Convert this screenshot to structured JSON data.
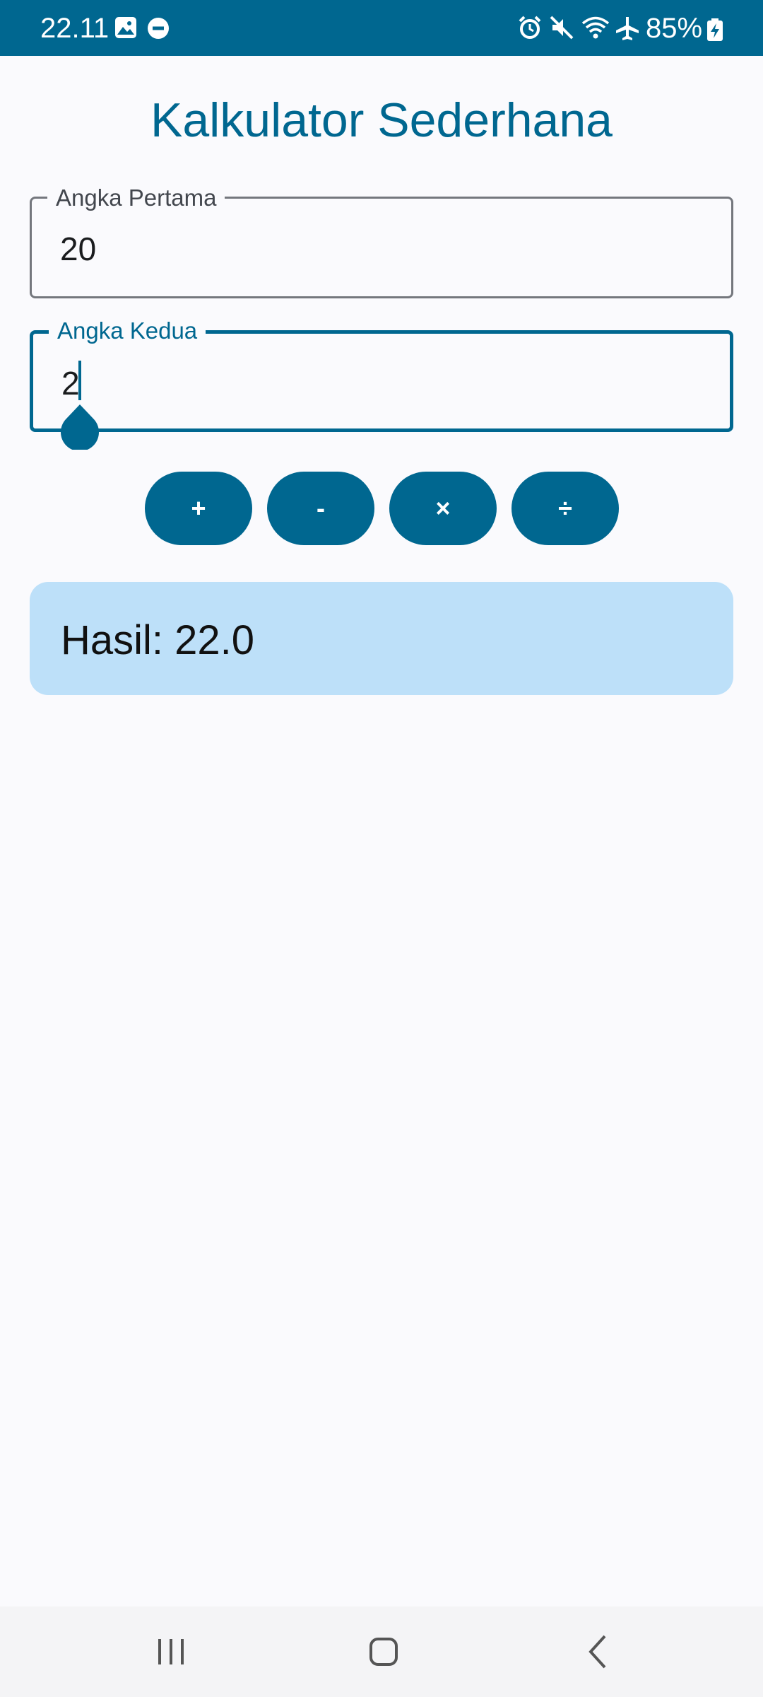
{
  "status_bar": {
    "time": "22.11",
    "battery": "85%",
    "icons": [
      "gallery-icon",
      "do-not-disturb-icon",
      "alarm-icon",
      "mute-icon",
      "wifi-icon",
      "airplane-icon",
      "battery-charging-icon"
    ]
  },
  "app": {
    "title": "Kalkulator Sederhana"
  },
  "fields": {
    "first": {
      "label": "Angka Pertama",
      "value": "20"
    },
    "second": {
      "label": "Angka Kedua",
      "value": "2"
    }
  },
  "operations": {
    "add": "+",
    "subtract": "-",
    "multiply": "×",
    "divide": "÷"
  },
  "result": {
    "text": "Hasil: 22.0"
  },
  "nav": {
    "icons": [
      "recent-apps-icon",
      "home-icon",
      "back-icon"
    ]
  },
  "colors": {
    "primary": "#006790",
    "result_background": "#bde0f9",
    "background": "#fafafd"
  }
}
